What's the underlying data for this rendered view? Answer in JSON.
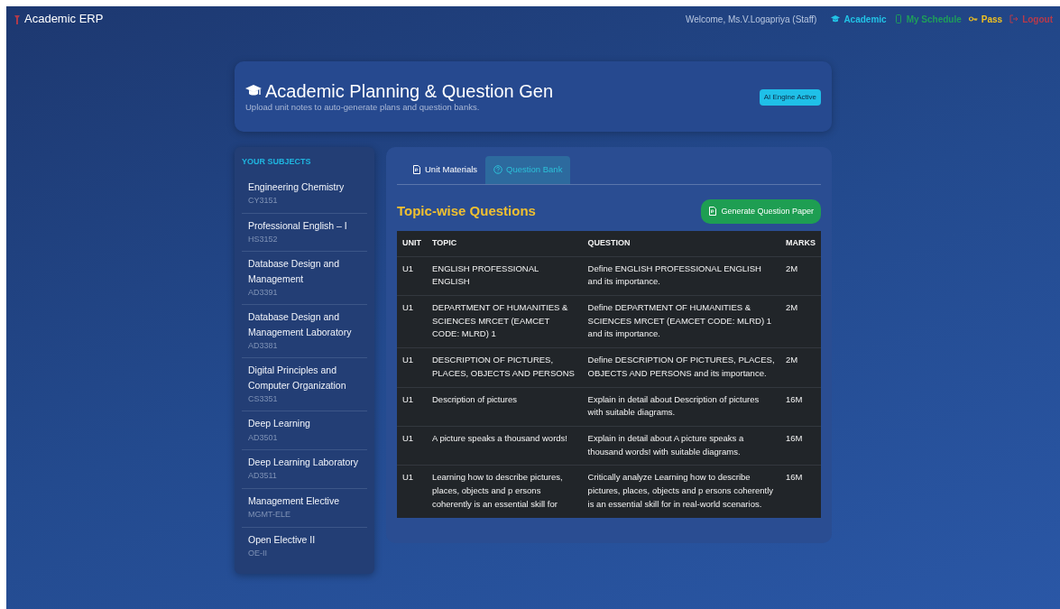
{
  "navbar": {
    "brand": "Academic ERP",
    "welcome": "Welcome, Ms.V.Logapriya (Staff)",
    "links": [
      {
        "label": "Academic",
        "color": "#22c3e6",
        "kind": "academic"
      },
      {
        "label": "My Schedule",
        "color": "#1e9e5a",
        "kind": "schedule"
      },
      {
        "label": "Pass",
        "color": "#f0c020",
        "kind": "pass"
      },
      {
        "label": "Logout",
        "color": "#b83a4a",
        "kind": "logout"
      }
    ]
  },
  "header": {
    "title": "Academic Planning & Question Gen",
    "subtitle": "Upload unit notes to auto-generate plans and question banks.",
    "badge": "AI Engine Active"
  },
  "sidebar": {
    "heading": "YOUR SUBJECTS",
    "subjects": [
      {
        "name": "Engineering Chemistry",
        "code": "CY3151"
      },
      {
        "name": "Professional English – I",
        "code": "HS3152"
      },
      {
        "name": "Database Design and Management",
        "code": "AD3391"
      },
      {
        "name": "Database Design and Management Laboratory",
        "code": "AD3381"
      },
      {
        "name": "Digital Principles and Computer Organization",
        "code": "CS3351"
      },
      {
        "name": "Deep Learning",
        "code": "AD3501"
      },
      {
        "name": "Deep Learning Laboratory",
        "code": "AD3511"
      },
      {
        "name": "Management Elective",
        "code": "MGMT-ELE"
      },
      {
        "name": "Open Elective II",
        "code": "OE-II"
      }
    ]
  },
  "tabs": [
    {
      "label": "Unit Materials",
      "kind": "materials",
      "selected": false
    },
    {
      "label": "Question Bank",
      "kind": "questions",
      "selected": true
    }
  ],
  "section_title": "Topic-wise Questions",
  "generate_button": "Generate Question Paper",
  "table": {
    "columns": [
      "UNIT",
      "TOPIC",
      "QUESTION",
      "MARKS"
    ],
    "rows": [
      [
        "U1",
        "ENGLISH PROFESSIONAL ENGLISH",
        "Define ENGLISH PROFESSIONAL ENGLISH and its importance.",
        "2M"
      ],
      [
        "U1",
        "DEPARTMENT OF HUMANITIES & SCIENCES MRCET (EAMCET CODE: MLRD) 1",
        "Define DEPARTMENT OF HUMANITIES & SCIENCES MRCET (EAMCET CODE: MLRD) 1 and its importance.",
        "2M"
      ],
      [
        "U1",
        "DESCRIPTION OF PICTURES, PLACES, OBJECTS AND PERSONS",
        "Define DESCRIPTION OF PICTURES, PLACES, OBJECTS AND PERSONS and its importance.",
        "2M"
      ],
      [
        "U1",
        "Description of pictures",
        "Explain in detail about Description of pictures with suitable diagrams.",
        "16M"
      ],
      [
        "U1",
        "A picture speaks a thousand words!",
        "Explain in detail about A picture speaks a thousand words! with suitable diagrams.",
        "16M"
      ],
      [
        "U1",
        "Learning how to describe pictures, places, objects and p ersons coherently is an essential skill for",
        "Critically analyze Learning how to describe pictures, places, objects and p ersons coherently is an essential skill for in real-world scenarios.",
        "16M"
      ]
    ]
  }
}
